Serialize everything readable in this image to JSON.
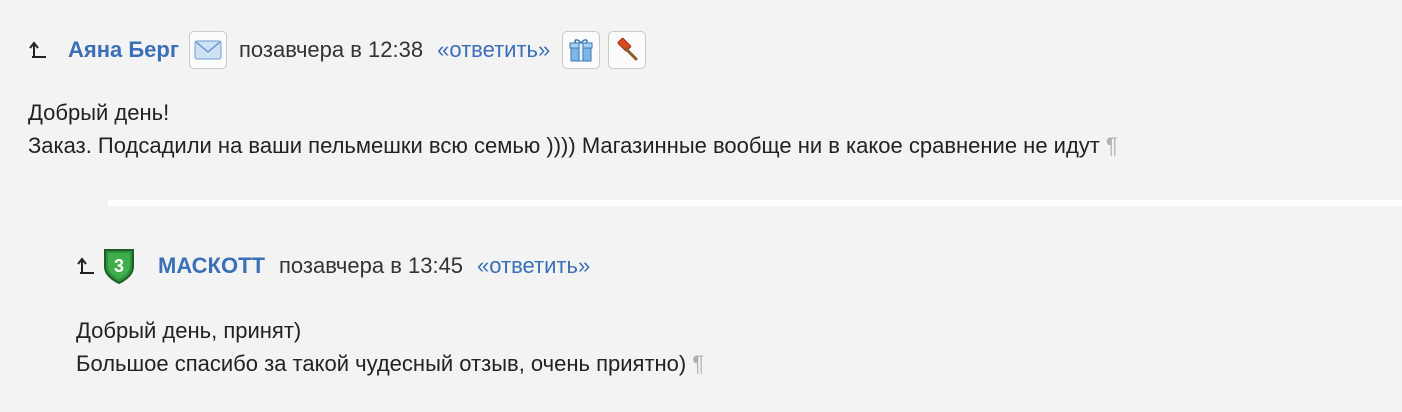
{
  "comments": [
    {
      "author": "Аяна Берг",
      "date": "позавчера в 12:38",
      "reply_label": "«ответить»",
      "lines": [
        "Добрый день!",
        "Заказ. Подсадили на ваши пельмешки всю семью )))) Магазинные вообще ни в какое сравнение не идут"
      ],
      "icons": [
        "envelope-icon",
        "gift-icon",
        "gavel-icon"
      ]
    },
    {
      "author": "МАСКОТТ",
      "date": "позавчера в 13:45",
      "reply_label": "«ответить»",
      "badge": "3",
      "lines": [
        "Добрый день, принят)",
        "Большое спасибо за такой чудесный отзыв, очень приятно)"
      ],
      "icons": [
        "shield-badge-icon"
      ]
    }
  ],
  "pilcrow": "¶",
  "colors": {
    "link": "#3b6fb6",
    "background": "#f3f3f3",
    "separator": "#ffffff",
    "badge": "#2f8f3a"
  }
}
